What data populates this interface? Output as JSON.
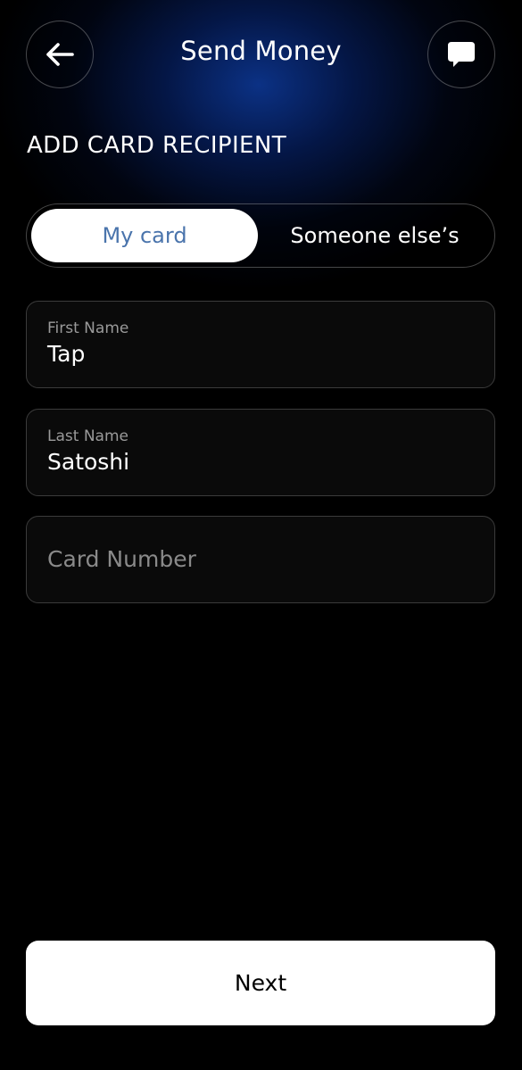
{
  "header": {
    "title": "Send Money",
    "back_icon": "arrow-left-icon",
    "chat_icon": "chat-bubble-icon"
  },
  "section": {
    "heading": "ADD CARD RECIPIENT"
  },
  "toggle": {
    "options": [
      "My card",
      "Someone else’s"
    ],
    "selected": "My card",
    "active_text_color": "#4a74ac"
  },
  "form": {
    "first_name": {
      "label": "First Name",
      "value": "Tap"
    },
    "last_name": {
      "label": "Last Name",
      "value": "Satoshi"
    },
    "card_number": {
      "placeholder": "Card Number",
      "value": ""
    }
  },
  "footer": {
    "next_label": "Next"
  },
  "colors": {
    "background": "#000000",
    "accent_glow": "#0c348c",
    "button_bg": "#ffffff"
  }
}
